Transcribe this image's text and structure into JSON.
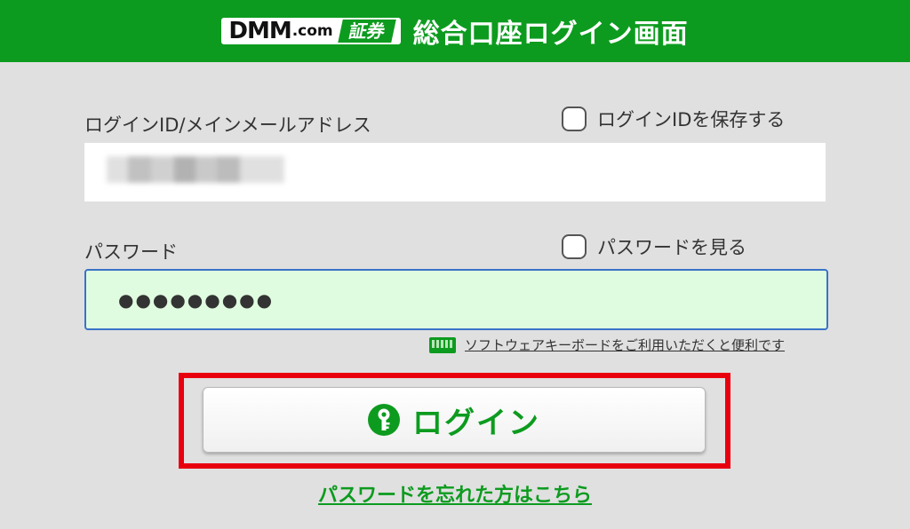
{
  "header": {
    "logo_dmm": "DMM",
    "logo_com": ".com",
    "logo_securities": "証券",
    "title": "総合口座ログイン画面"
  },
  "form": {
    "id_label": "ログインID/メインメールアドレス",
    "save_id_label": "ログインIDを保存する",
    "password_label": "パスワード",
    "show_password_label": "パスワードを見る",
    "password_mask": "●●●●●●●●●",
    "soft_keyboard_link": "ソフトウェアキーボードをご利用いただくと便利です"
  },
  "login_button": {
    "label": "ログイン"
  },
  "forgot_password_link": "パスワードを忘れた方はこちら",
  "colors": {
    "brand_green": "#0d9b1f",
    "highlight_red": "#e8000f",
    "focus_blue": "#3a73c8"
  }
}
